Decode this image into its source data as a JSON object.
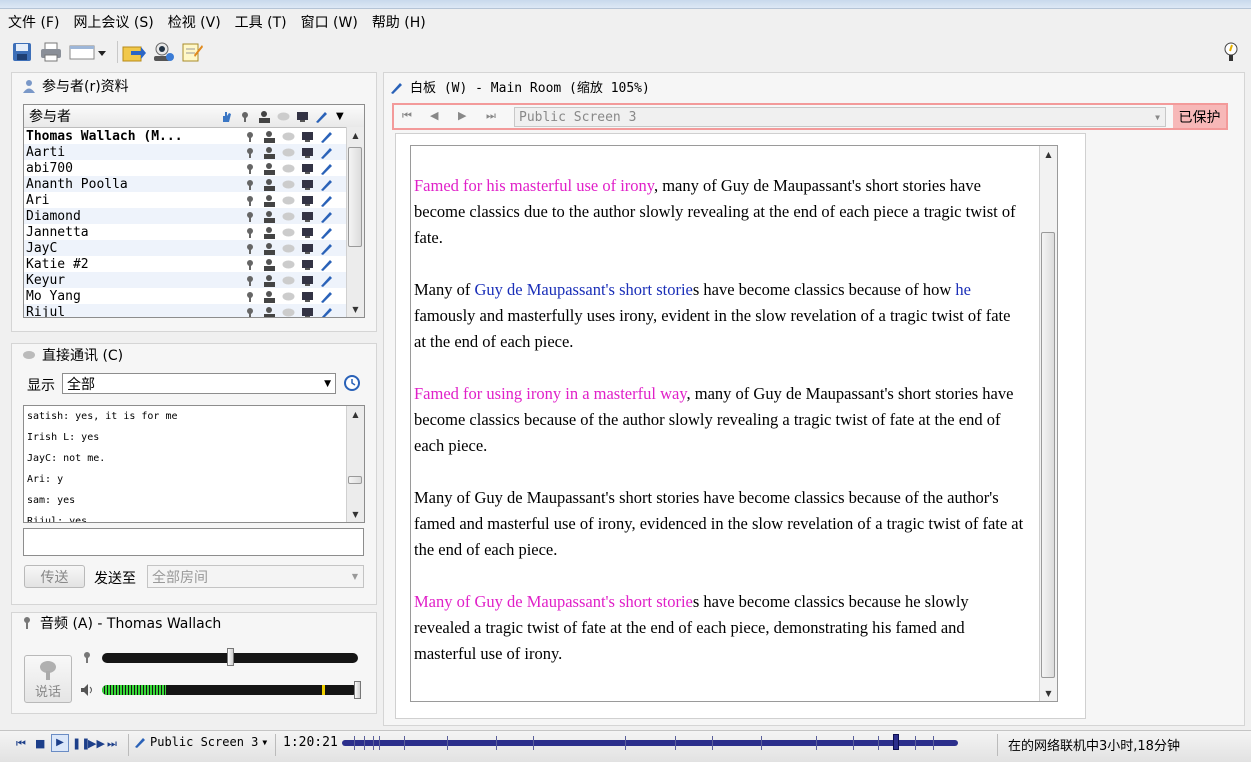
{
  "menu": [
    "文件 (F)",
    "网上会议 (S)",
    "检视 (V)",
    "工具 (T)",
    "窗口 (W)",
    "帮助 (H)"
  ],
  "toolbar": {
    "icons": [
      "save-icon",
      "print-icon",
      "layout-icon",
      "share-icon",
      "webcam-icon",
      "notes-icon",
      "help-icon"
    ]
  },
  "participants": {
    "title": "参与者(r)资料",
    "column": "参与者",
    "names": [
      "Thomas Wallach (M...",
      "Aarti",
      "abi700",
      "Ananth Poolla",
      "Ari",
      "Diamond",
      "Jannetta",
      "JayC",
      "Katie #2",
      "Keyur",
      "Mo Yang",
      "Rijul"
    ]
  },
  "chat": {
    "title": "直接通讯 (C)",
    "show_label": "显示",
    "show_value": "全部",
    "messages": [
      "satish: yes, it is for me",
      "Irish L: yes",
      "JayC: not me.",
      "Ari: y",
      "sam: yes",
      "Rijul: yes"
    ],
    "send_label": "传送",
    "send_to_label": "发送至",
    "send_to_value": "全部房间"
  },
  "audio": {
    "title": "音频 (A) - Thomas Wallach",
    "talk_label": "说话",
    "mic_level": 0.0,
    "speaker_level": 0.25
  },
  "whiteboard": {
    "title": "白板 (W) - Main Room (缩放 105%)",
    "screen_select": "Public Screen 3",
    "protected_label": "已保护",
    "paragraphs": [
      {
        "a": "Famed for his masterful use of irony",
        "b": ", many of Guy de Maupassant's short stories have become classics due to the author slowly revealing at the end of each piece a tragic twist of fate."
      },
      {
        "pre": "Many of ",
        "a": "Guy de Maupassant's short storie",
        "b": "s have become classics because of how ",
        "c": "he",
        "d": " famously and masterfully uses irony, evident in the slow revelation of a tragic twist of fate at the end of each piece."
      },
      {
        "a": "Famed for using irony in a masterful way",
        "b": ", many of Guy de Maupassant's short stories have become classics because of the author slowly revealing a tragic twist of fate at the end of each piece."
      },
      {
        "b": "Many of Guy de Maupassant's short stories have become classics because of the author's famed and masterful use of irony, evidenced in the slow revelation of a tragic twist of fate at the end of each piece."
      },
      {
        "a": "Many of Guy de Maupassant's short storie",
        "b": "s have become classics because he slowly revealed a tragic twist of fate at the end of each piece, demonstrating his famed and masterful use of irony."
      }
    ]
  },
  "playback": {
    "screen_label": "Public Screen 3",
    "time": "1:20:21",
    "status": "在的网络联机中3小时,18分钟",
    "progress": 0.9
  },
  "colors": {
    "highlight_magenta": "#e020c8",
    "highlight_blue": "#1a2fb8",
    "protected_bg": "#f7b8b8"
  }
}
